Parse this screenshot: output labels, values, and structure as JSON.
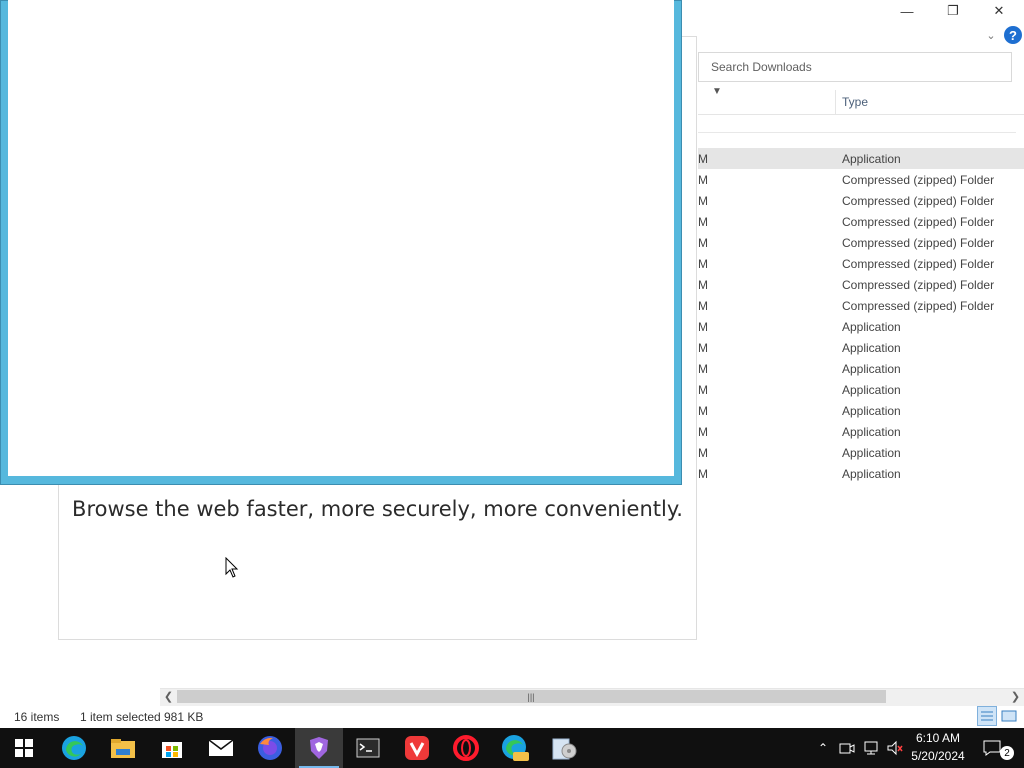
{
  "explorer": {
    "search_placeholder": "Search Downloads",
    "column_type": "Type",
    "rows": [
      {
        "cut": "M",
        "type": "Application",
        "selected": true
      },
      {
        "cut": "M",
        "type": "Compressed (zipped) Folder"
      },
      {
        "cut": "M",
        "type": "Compressed (zipped) Folder"
      },
      {
        "cut": "M",
        "type": "Compressed (zipped) Folder"
      },
      {
        "cut": "M",
        "type": "Compressed (zipped) Folder"
      },
      {
        "cut": "M",
        "type": "Compressed (zipped) Folder"
      },
      {
        "cut": "M",
        "type": "Compressed (zipped) Folder"
      },
      {
        "cut": "M",
        "type": "Compressed (zipped) Folder"
      },
      {
        "cut": "M",
        "type": "Application"
      },
      {
        "cut": "M",
        "type": "Application"
      },
      {
        "cut": "M",
        "type": "Application"
      },
      {
        "cut": "M",
        "type": "Application"
      },
      {
        "cut": "M",
        "type": "Application"
      },
      {
        "cut": "M",
        "type": "Application"
      },
      {
        "cut": "M",
        "type": "Application"
      },
      {
        "cut": "M",
        "type": "Application"
      }
    ],
    "status": {
      "items": "16 items",
      "selected": "1 item selected",
      "size": "981 KB"
    },
    "window_buttons": {
      "minimize": "—",
      "restore": "❐",
      "close": "✕"
    },
    "help": "?"
  },
  "installer": {
    "tagline": "Browse the web faster, more securely, more conveniently."
  },
  "taskbar": {
    "apps": [
      "windows-start",
      "edge",
      "file-explorer",
      "store",
      "mail",
      "firefox",
      "brave",
      "terminal",
      "vivaldi",
      "opera",
      "edge-canary",
      "installer"
    ],
    "active_app": "brave",
    "time": "6:10 AM",
    "date": "5/20/2024",
    "notifications": "2"
  },
  "colors": {
    "accent": "#56b8dd",
    "taskbar": "#101010",
    "selection": "#e5e5e5"
  }
}
